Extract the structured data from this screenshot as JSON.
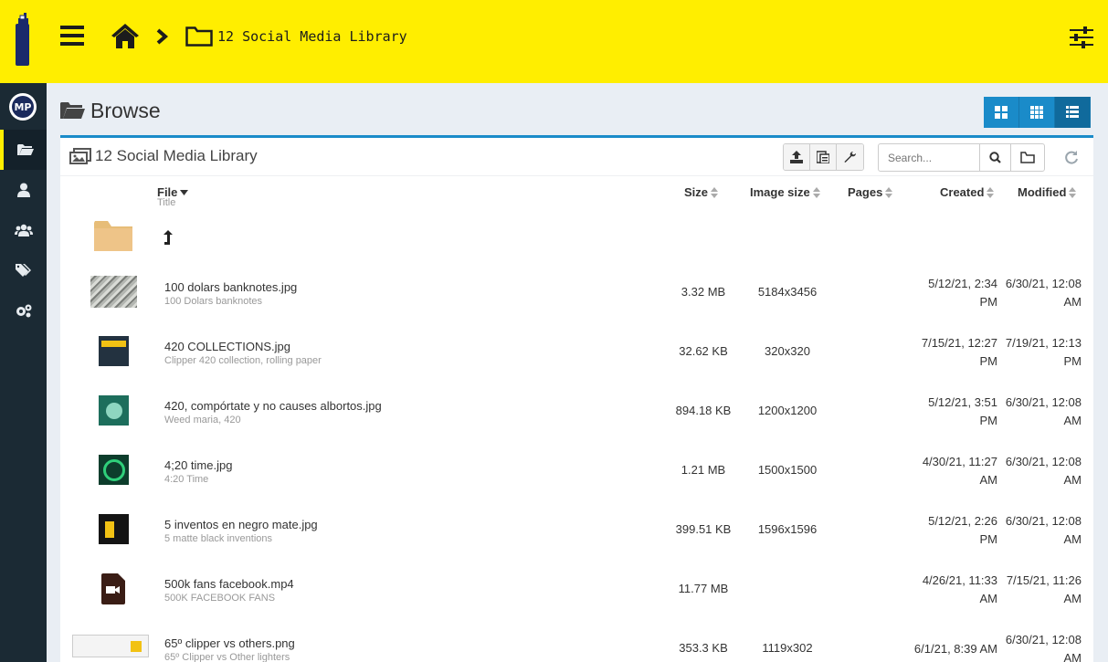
{
  "header": {
    "breadcrumb_folder": "12 Social Media Library"
  },
  "browse": {
    "title": "Browse"
  },
  "panel": {
    "title": "12 Social Media Library",
    "search_placeholder": "Search..."
  },
  "columns": {
    "file": "File",
    "file_sub": "Title",
    "size": "Size",
    "image_size": "Image size",
    "pages": "Pages",
    "created": "Created",
    "modified": "Modified"
  },
  "colors": {
    "topbar": "#ffee00",
    "sidebar": "#1b2a34",
    "accent": "#1a8bc9"
  },
  "rows": [
    {
      "name": "100 dolars banknotes.jpg",
      "title": "100 Dolars banknotes",
      "size": "3.32 MB",
      "image_size": "5184x3456",
      "created_1": "5/12/21, 2:34",
      "created_2": "PM",
      "modified_1": "6/30/21, 12:08",
      "modified_2": "AM"
    },
    {
      "name": "420 COLLECTIONS.jpg",
      "title": "Clipper 420 collection, rolling paper",
      "size": "32.62 KB",
      "image_size": "320x320",
      "created_1": "7/15/21, 12:27",
      "created_2": "PM",
      "modified_1": "7/19/21, 12:13",
      "modified_2": "PM"
    },
    {
      "name": "420, compórtate y no causes albortos.jpg",
      "title": "Weed maria, 420",
      "size": "894.18 KB",
      "image_size": "1200x1200",
      "created_1": "5/12/21, 3:51",
      "created_2": "PM",
      "modified_1": "6/30/21, 12:08",
      "modified_2": "AM"
    },
    {
      "name": "4;20 time.jpg",
      "title": "4:20 Time",
      "size": "1.21 MB",
      "image_size": "1500x1500",
      "created_1": "4/30/21, 11:27",
      "created_2": "AM",
      "modified_1": "6/30/21, 12:08",
      "modified_2": "AM"
    },
    {
      "name": "5 inventos en negro mate.jpg",
      "title": "5 matte black inventions",
      "size": "399.51 KB",
      "image_size": "1596x1596",
      "created_1": "5/12/21, 2:26",
      "created_2": "PM",
      "modified_1": "6/30/21, 12:08",
      "modified_2": "AM"
    },
    {
      "name": "500k fans facebook.mp4",
      "title": "500K FACEBOOK FANS",
      "size": "11.77 MB",
      "image_size": "",
      "created_1": "4/26/21, 11:33",
      "created_2": "AM",
      "modified_1": "7/15/21, 11:26",
      "modified_2": "AM"
    },
    {
      "name": "65º clipper vs others.png",
      "title": "65º Clipper vs Other lighters",
      "size": "353.3 KB",
      "image_size": "1119x302",
      "created_1": "6/1/21, 8:39 AM",
      "created_2": "",
      "modified_1": "6/30/21, 12:08",
      "modified_2": "AM"
    }
  ],
  "icons": [
    "logo-icon",
    "hamburger-icon",
    "home-icon",
    "chevron-right-icon",
    "folder-icon",
    "sliders-icon",
    "folder-open-icon",
    "user-icon",
    "users-icon",
    "tags-icon",
    "cogs-icon",
    "upload-icon",
    "list-icon",
    "wrench-icon",
    "search-icon",
    "refresh-icon",
    "level-up-icon",
    "video-icon"
  ]
}
